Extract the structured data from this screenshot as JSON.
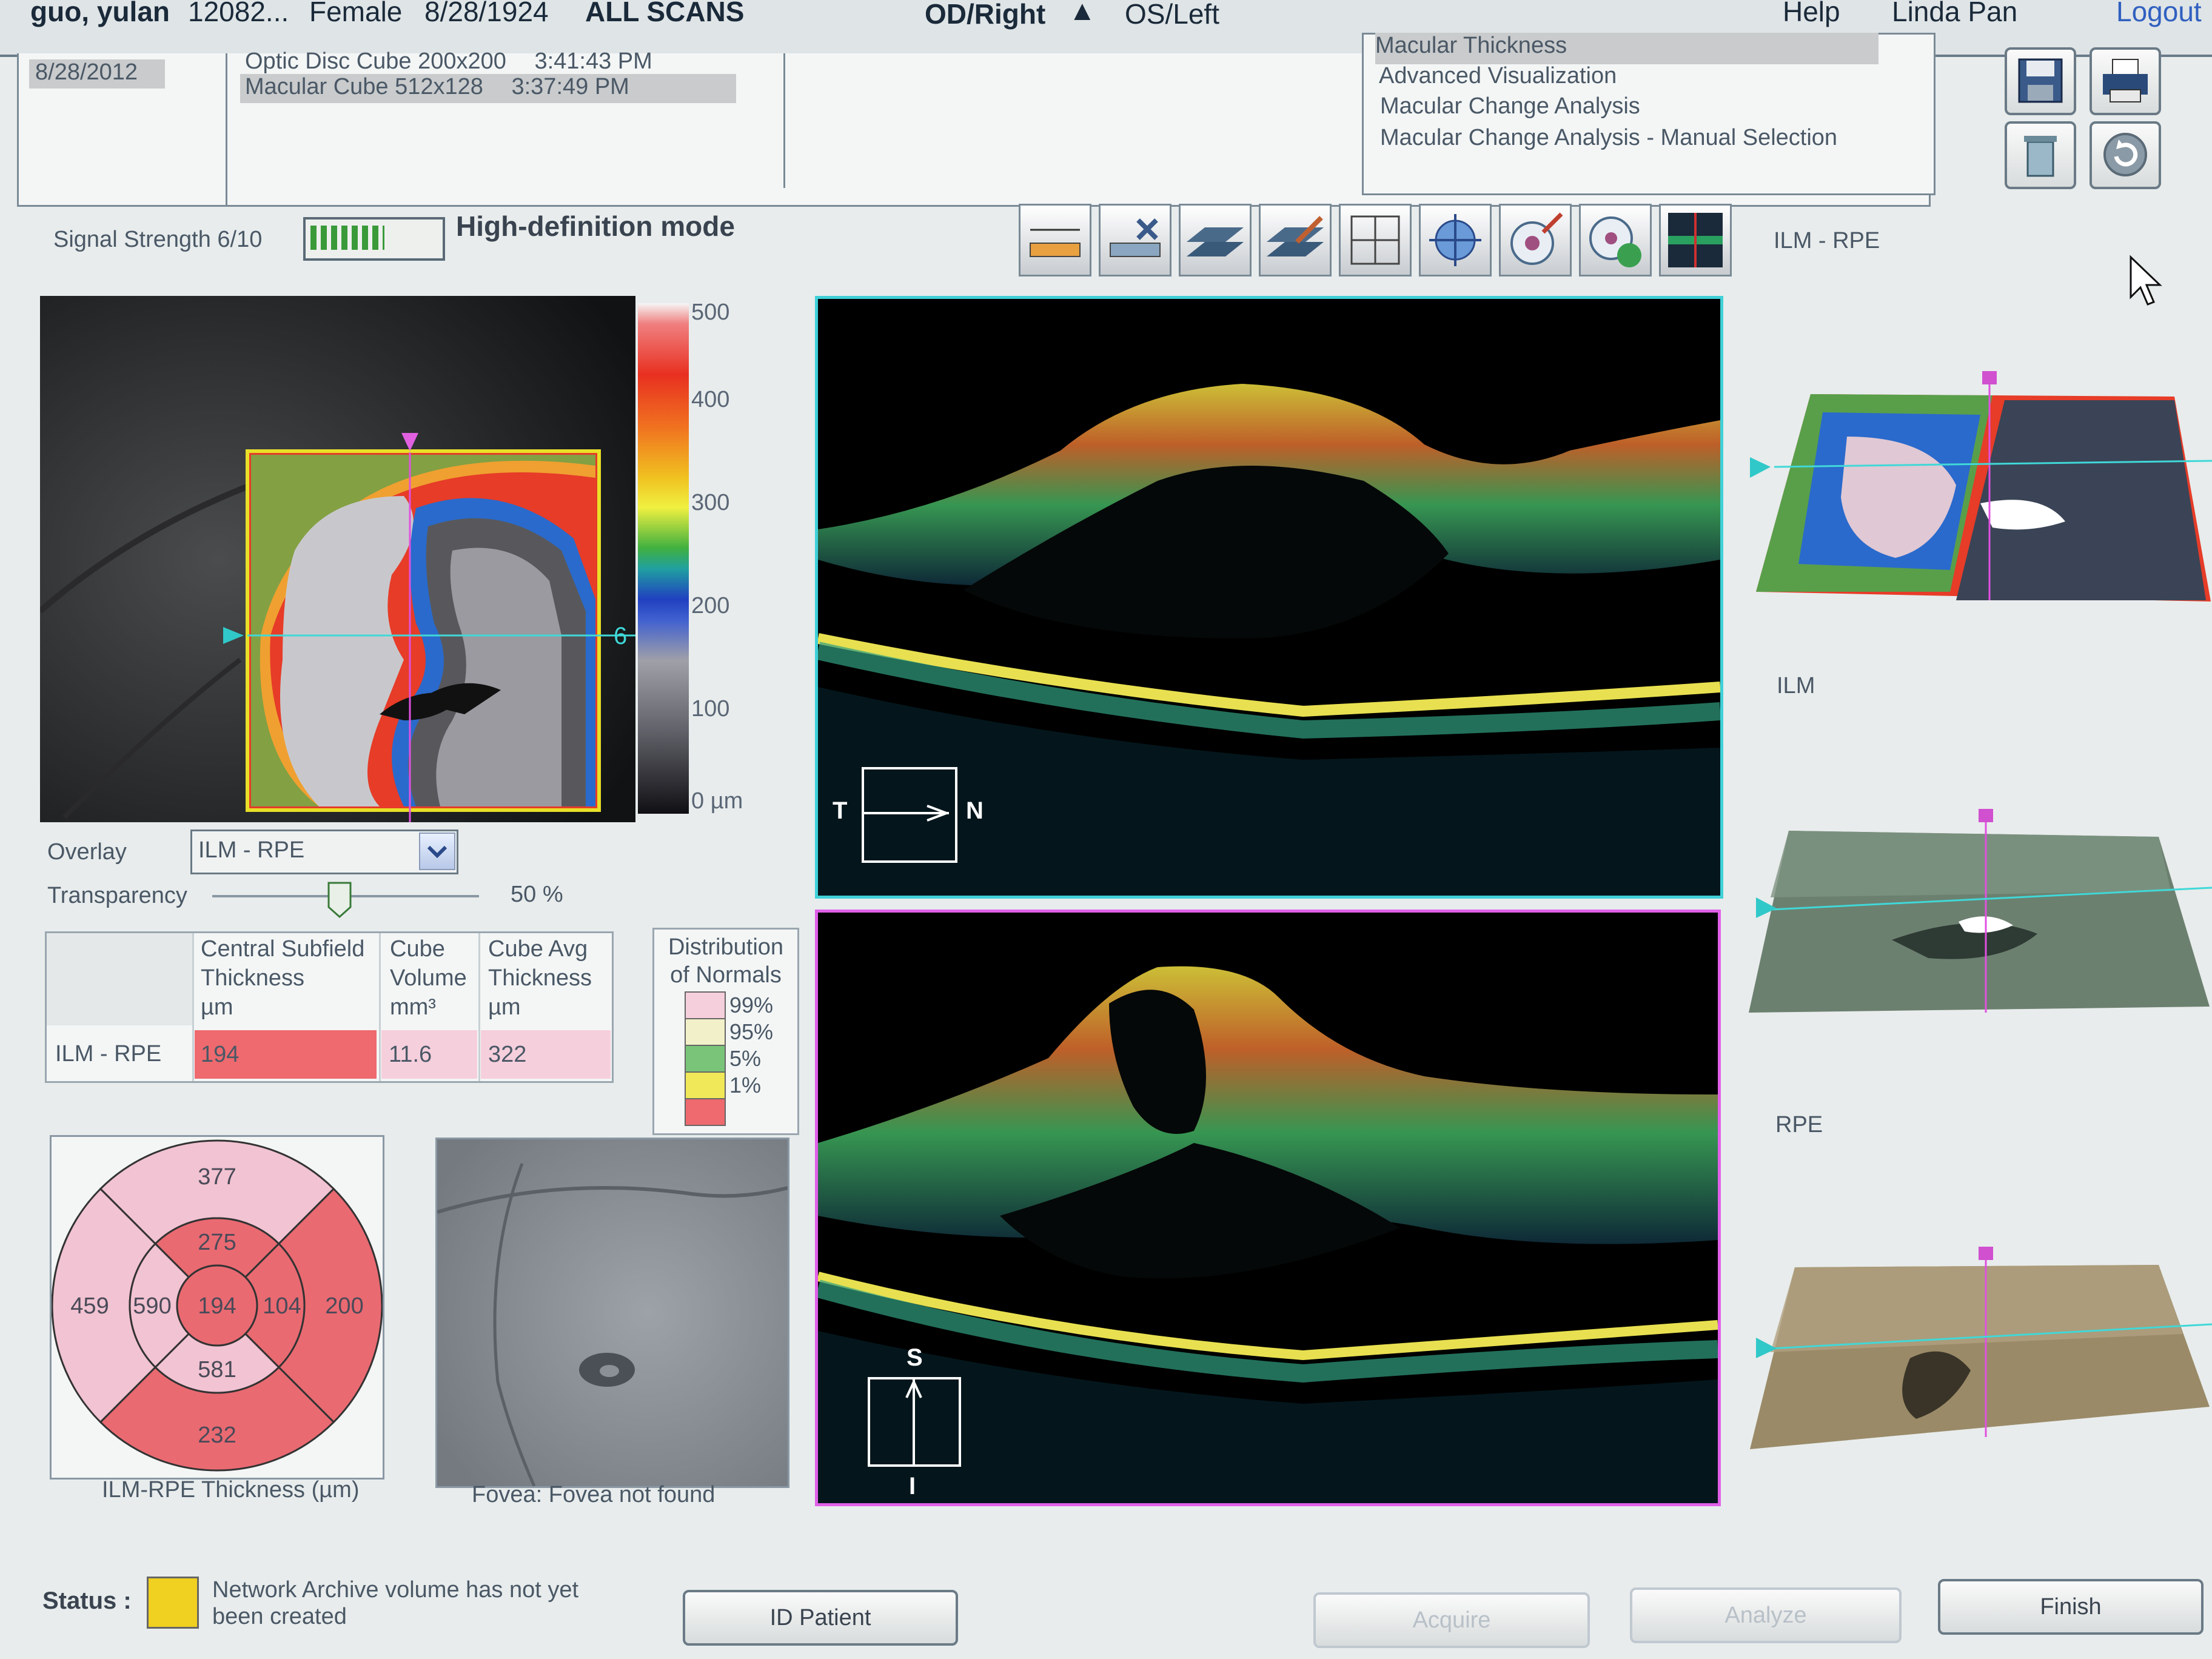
{
  "header": {
    "patient_name": "guo, yulan",
    "patient_id": "12082...",
    "gender": "Female",
    "dob": "8/28/1924",
    "all_scans": "ALL SCANS",
    "eye_right": "OD/Right",
    "eye_left": "OS/Left",
    "help": "Help",
    "user": "Linda Pan",
    "logout": "Logout"
  },
  "visits": {
    "date": "8/28/2012",
    "scans": [
      {
        "name": "Optic Disc Cube 200x200",
        "time": "3:41:43 PM"
      },
      {
        "name": "Macular Cube 512x128",
        "time": "3:37:49 PM"
      }
    ]
  },
  "analyses": [
    "Macular Thickness",
    "Advanced Visualization",
    "Macular Change Analysis",
    "Macular Change Analysis - Manual Selection"
  ],
  "signal": {
    "label": "Signal Strength 6/10",
    "mode": "High-definition mode",
    "strength": 6,
    "max": 10
  },
  "colorbar": {
    "ticks": [
      "500",
      "400",
      "300",
      "200",
      "100",
      "0 µm"
    ]
  },
  "fundus": {
    "line_label": "6"
  },
  "overlay": {
    "label": "Overlay",
    "value": "ILM - RPE",
    "transparency_label": "Transparency",
    "transparency_value": "50 %",
    "transparency_pct": 50
  },
  "thickness_table": {
    "headers": [
      [
        "Central Subfield",
        "Thickness",
        "µm"
      ],
      [
        "Cube",
        "Volume",
        "mm³"
      ],
      [
        "Cube Avg",
        "Thickness",
        "µm"
      ]
    ],
    "row_label": "ILM - RPE",
    "values": [
      "194",
      "11.6",
      "322"
    ],
    "colors": [
      "#ee6a6e",
      "#f6cfdc",
      "#f6cfdc"
    ]
  },
  "normals": {
    "title_line1": "Distribution",
    "title_line2": "of Normals",
    "items": [
      {
        "label": "99%",
        "color": "#f6cfdc"
      },
      {
        "label": "95%",
        "color": "#f2f0c8"
      },
      {
        "label": "5%",
        "color": "#7ac47a"
      },
      {
        "label": "1%",
        "color": "#f0e858"
      },
      {
        "label": "",
        "color": "#ee6a6e"
      }
    ]
  },
  "etdrs": {
    "caption": "ILM-RPE Thickness (µm)",
    "center": "194",
    "inner_superior": "275",
    "inner_temporal": "590",
    "inner_nasal": "104",
    "inner_inferior": "581",
    "outer_superior": "377",
    "outer_temporal": "459",
    "outer_nasal": "200",
    "outer_inferior": "232",
    "color_pink": "#f2c3d2",
    "color_red": "#ea6a72"
  },
  "fovea": {
    "caption": "Fovea:  Fovea not found"
  },
  "bscans": {
    "h_left": "T",
    "h_right": "N",
    "v_top": "S",
    "v_bottom": "I"
  },
  "surfaces": [
    "ILM - RPE",
    "ILM",
    "RPE"
  ],
  "status": {
    "label": "Status :",
    "message_line1": "Network Archive volume has not yet",
    "message_line2": "been created",
    "color": "#f0d020"
  },
  "buttons": {
    "id_patient": "ID Patient",
    "acquire": "Acquire",
    "analyze": "Analyze",
    "finish": "Finish"
  }
}
